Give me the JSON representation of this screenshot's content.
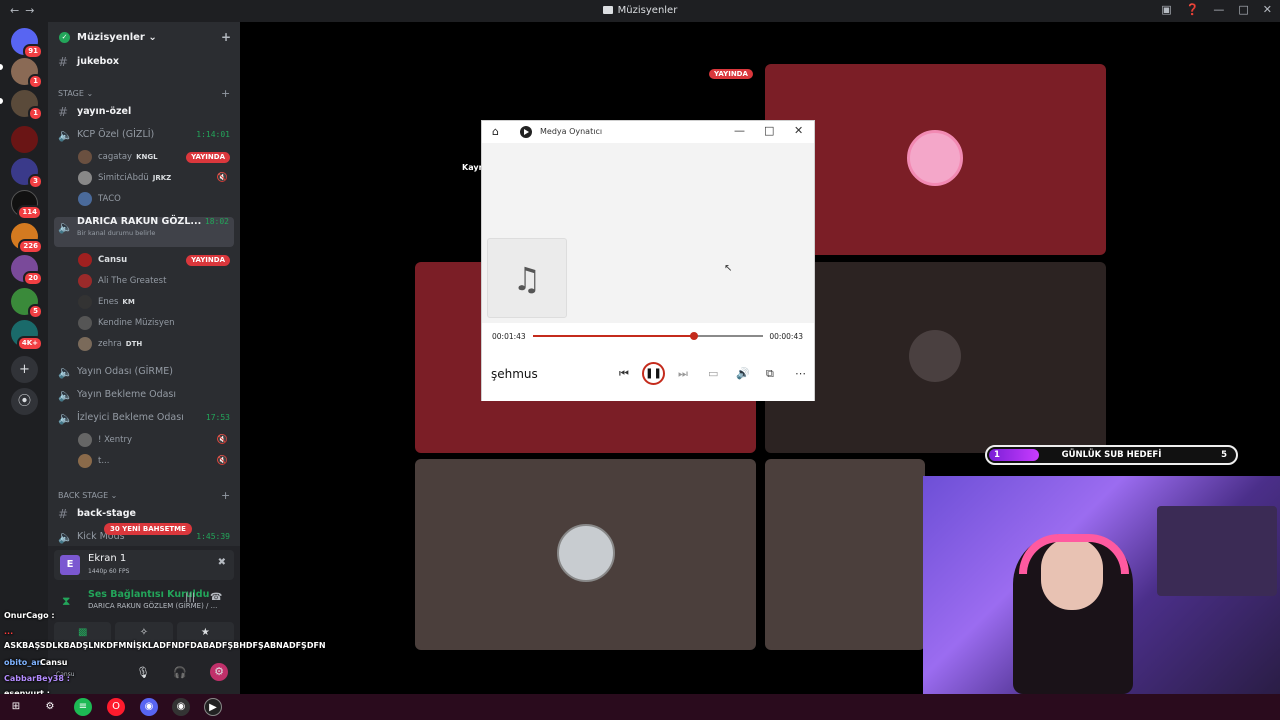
{
  "window": {
    "title": "Müzisyenler"
  },
  "server": {
    "name": "Müzisyenler",
    "badges": [
      "91",
      "1",
      "1",
      "3",
      "114",
      "226",
      "20",
      "5",
      "4K+"
    ]
  },
  "channels": {
    "jukebox": "jukebox",
    "stage_category": "STAGE",
    "yayin_ozel": "yayın-özel",
    "kcp": {
      "name": "KCP Özel (GİZLİ)",
      "time": "1:14:01"
    },
    "kcp_users": [
      {
        "name": "cagatay",
        "tag": "KNGL",
        "live": "YAYINDA"
      },
      {
        "name": "SimitciAbdü",
        "tag": "JRKZ"
      },
      {
        "name": "TACO"
      }
    ],
    "darica": {
      "name": "DARICA RAKUN GÖZL...",
      "time": "18:02",
      "status": "Bir kanal durumu belirle"
    },
    "darica_users": [
      {
        "name": "Cansu",
        "live": "YAYINDA"
      },
      {
        "name": "Ali The Greatest"
      },
      {
        "name": "Enes",
        "tag": "KM"
      },
      {
        "name": "Kendine Müzisyen"
      },
      {
        "name": "zehra",
        "tag": "DTH"
      }
    ],
    "yayin_odasi": "Yayın Odası (GİRME)",
    "yayin_bekleme": "Yayın Bekleme Odası",
    "izleyici": {
      "name": "İzleyici Bekleme Odası",
      "time": "17:53"
    },
    "izleyici_users": [
      {
        "name": "! Xentry"
      },
      {
        "name": "t..."
      }
    ],
    "backstage_category": "BACK STAGE",
    "backstage": "back-stage",
    "kick_mods": {
      "name": "Kick Mods",
      "time": "1:45:39"
    }
  },
  "voice_panel": {
    "screen_title": "Ekran 1",
    "screen_sub": "1440p 60 FPS",
    "connection": "Ses Bağlantısı Kuruldu",
    "connection_channel": "DARICA RAKUN GÖZLEM (GİRME) / ...",
    "user_name": "Cansu",
    "user_status": "Cansu"
  },
  "stream": {
    "yayinda": "YAYINDA",
    "kayr": "Kayr",
    "promo": "30 YENİ BAHSETME",
    "goal": {
      "current": "1",
      "label": "GÜNLÜK SUB HEDEFİ",
      "target": "5",
      "progress": 0.2
    }
  },
  "chat": [
    {
      "user": "OnurCago :"
    },
    {
      "user": "..."
    },
    {
      "text": "ASKBAŞSDLKBADŞLNKDFMNİŞKLADFNDFDABADFŞBHDFŞABNADFŞDFN"
    },
    {
      "user": "obito_an"
    },
    {
      "user": "CabbarBey38 :"
    },
    {
      "user": "esenyurt :"
    }
  ],
  "media_player": {
    "app_title": "Medya Oynatıcı",
    "elapsed": "00:01:43",
    "remaining": "00:00:43",
    "progress": 0.7,
    "track": "şehmus"
  },
  "icons": {
    "music": "music-note-icon",
    "play": "pause-icon"
  }
}
